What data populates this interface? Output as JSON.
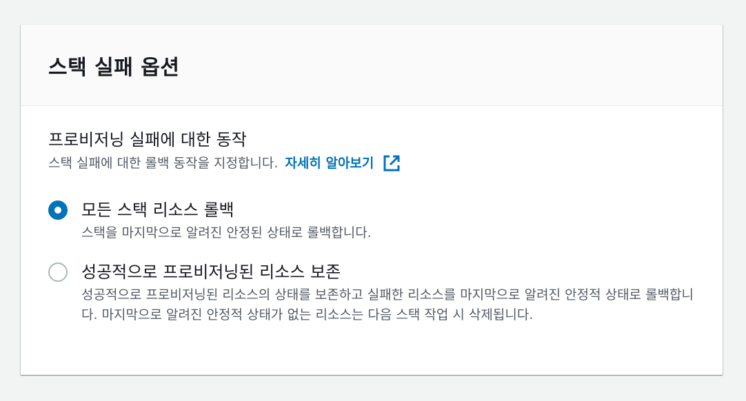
{
  "panel": {
    "title": "스택 실패 옵션"
  },
  "field": {
    "label": "프로비저닝 실패에 대한 동작",
    "description": "스택 실패에 대한 롤백 동작을 지정합니다.",
    "learn_more": "자세히 알아보기",
    "learn_more_icon": "external-link-icon"
  },
  "options": [
    {
      "label": "모든 스택 리소스 롤백",
      "description": "스택을 마지막으로 알려진 안정된 상태로 롤백합니다.",
      "selected": true
    },
    {
      "label": "성공적으로 프로비저닝된 리소스 보존",
      "description": "성공적으로 프로비저닝된 리소스의 상태를 보존하고 실패한 리소스를 마지막으로 알려진 안정적 상태로 롤백합니다. 마지막으로 알려진 안정적 상태가 없는 리소스는 다음 스택 작업 시 삭제됩니다.",
      "selected": false
    }
  ],
  "colors": {
    "accent": "#0073bb",
    "text_primary": "#16191f",
    "text_secondary": "#545b64",
    "radio_border": "#aab7b8",
    "header_bg": "#fafafa",
    "page_bg": "#f2f3f3"
  }
}
